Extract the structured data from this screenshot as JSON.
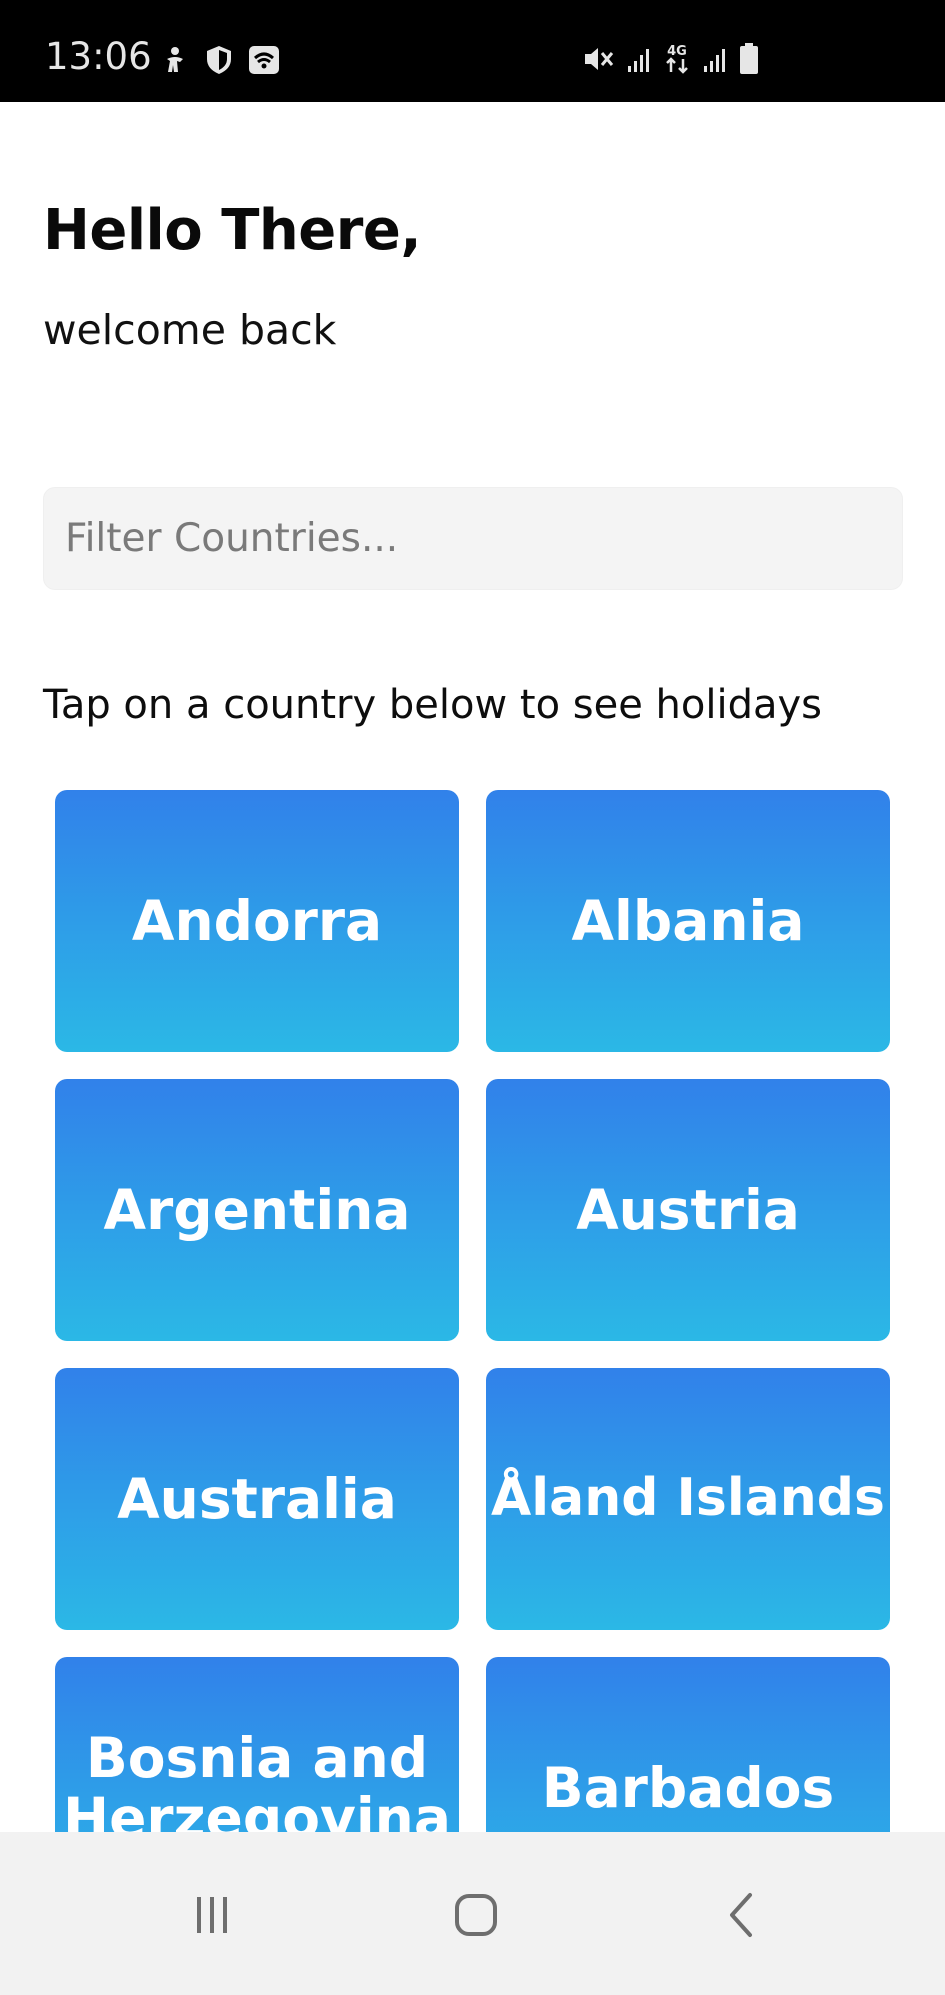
{
  "status_bar": {
    "time": "13:06",
    "left_icons": [
      "accessibility-icon",
      "shield-icon",
      "wifi-call-icon"
    ],
    "right_icons": [
      "mute-icon",
      "signal-icon",
      "4g-data-icon",
      "signal-icon",
      "battery-icon"
    ],
    "network_label": "4G"
  },
  "header": {
    "title": "Hello There,",
    "subtitle": "welcome back"
  },
  "search": {
    "placeholder": "Filter Countries...",
    "value": ""
  },
  "instructions": "Tap on a country below to see holidays",
  "countries": [
    "Andorra",
    "Albania",
    "Argentina",
    "Austria",
    "Australia",
    "Åland Islands",
    "Bosnia and Herzegovina",
    "Barbados"
  ],
  "colors": {
    "card_gradient_top": "#3181ea",
    "card_gradient_bottom": "#2bb8e6",
    "status_bar": "#000000",
    "nav_bar": "#f2f2f2",
    "search_bg": "#f4f4f4"
  },
  "nav_bar": {
    "buttons": [
      "recents-icon",
      "home-icon",
      "back-icon"
    ]
  }
}
